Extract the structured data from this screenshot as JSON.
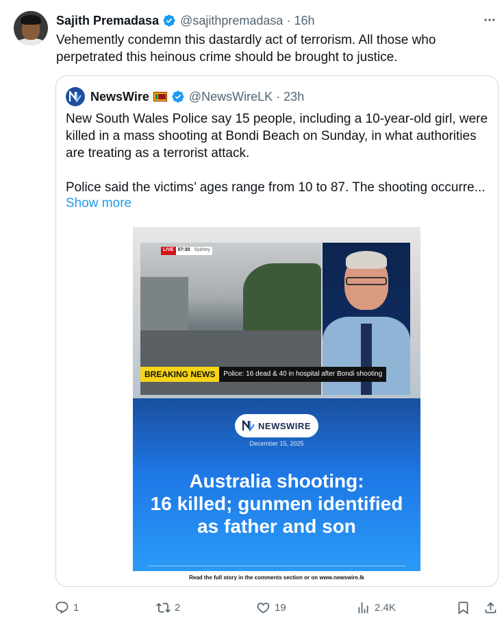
{
  "author": {
    "name": "Sajith Premadasa",
    "handle": "@sajithpremadasa",
    "time": "16h"
  },
  "more_icon": "more-horizontal-icon",
  "tweet_text": "Vehemently condemn this dastardly act of terrorism. All those who perpetrated this heinous crime should be brought to justice.",
  "quote": {
    "name": "NewsWire",
    "flag": "Sri Lanka flag",
    "handle": "@NewsWireLK",
    "time": "23h",
    "paragraph1": "New South Wales Police say 15 people, including a 10-year-old girl, were killed in a mass shooting at Bondi Beach on Sunday, in what authorities are treating as a terrorist attack.",
    "paragraph2": "Police said the victims’ ages range from 10 to 87. The shooting occurre...",
    "show_more": "Show more",
    "media": {
      "live_label": "LIVE",
      "live_time": "07:30",
      "live_city": "Sydney",
      "breaking_label": "BREAKING NEWS",
      "breaking_text": "Police: 16 dead & 40 in hospital after Bondi shooting",
      "brand": "NEWSWIRE",
      "date": "December 15, 2025",
      "headline_line1": "Australia shooting:",
      "headline_line2": "16 killed; gunmen identified",
      "headline_line3": "as father and son",
      "caption": "Read the full story in the comments section or on www.newswire.lk"
    }
  },
  "actions": {
    "replies": "1",
    "reposts": "2",
    "likes": "19",
    "views": "2.4K"
  },
  "colors": {
    "text": "#0f1419",
    "muted": "#536471",
    "link": "#1d9bf0",
    "verified": "#1d9bf0",
    "border": "#cfd9de"
  }
}
